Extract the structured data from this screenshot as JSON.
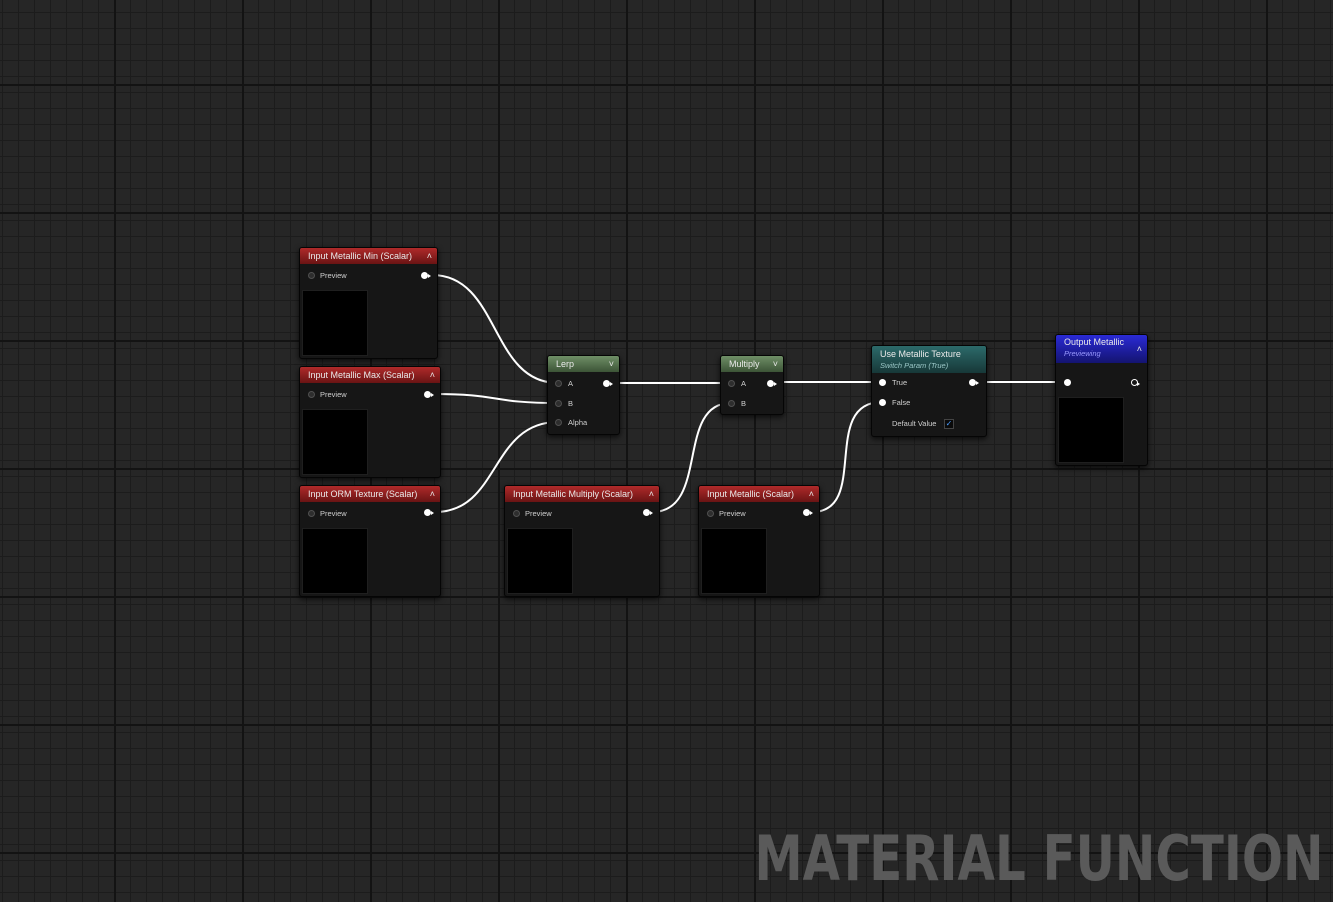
{
  "colors": {
    "input_header": "#9a2222",
    "operation_header": "#5a7752",
    "switch_header": "#235656",
    "output_header": "#2020b8",
    "wire": "#ffffff",
    "grid_background": "#262626"
  },
  "nodes": {
    "input_min": {
      "title": "Input Metallic Min (Scalar)",
      "preview_label": "Preview"
    },
    "input_max": {
      "title": "Input Metallic Max (Scalar)",
      "preview_label": "Preview"
    },
    "input_orm": {
      "title": "Input ORM Texture (Scalar)",
      "preview_label": "Preview"
    },
    "input_multiply": {
      "title": "Input Metallic Multiply (Scalar)",
      "preview_label": "Preview"
    },
    "input_metallic": {
      "title": "Input Metallic (Scalar)",
      "preview_label": "Preview"
    },
    "lerp": {
      "title": "Lerp",
      "pins": [
        "A",
        "B",
        "Alpha"
      ]
    },
    "multiply": {
      "title": "Multiply",
      "pins": [
        "A",
        "B"
      ]
    },
    "switch": {
      "title": "Use Metallic Texture",
      "subtitle": "Switch Param (True)",
      "pins": [
        "True",
        "False"
      ],
      "default_label": "Default Value",
      "default_checked": true
    },
    "output": {
      "title": "Output Metallic",
      "subtitle": "Previewing"
    }
  },
  "icons": {
    "collapse": "chevron-up-icon",
    "expand": "chevron-down-icon",
    "check": "checkmark-icon"
  },
  "watermark": "MATERIAL FUNCTION"
}
